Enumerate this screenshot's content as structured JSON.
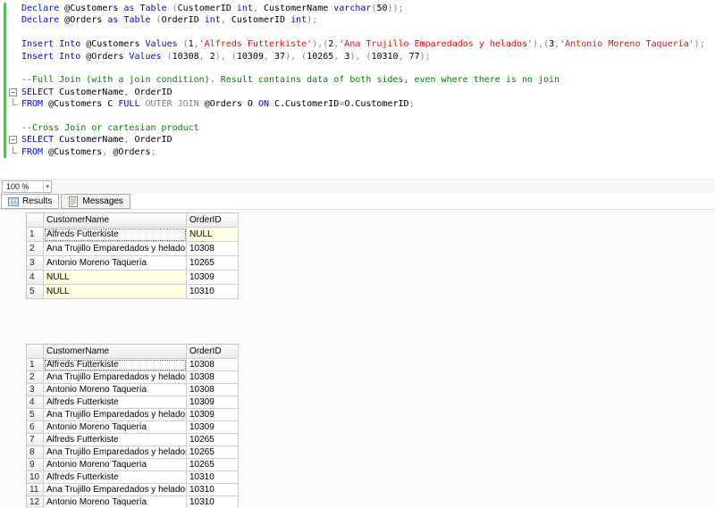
{
  "colors": {
    "keyword_blue": "#0000ff",
    "string_red": "#ff0000",
    "comment_green": "#008000",
    "operator_gray": "#808080",
    "null_cell_yellow": "#ffffe1",
    "change_bar_green": "#5bb75b"
  },
  "editor": {
    "zoom_label": "100 %",
    "lines": [
      {
        "tokens": [
          [
            "kw",
            "Declare"
          ],
          [
            "pl",
            " @Customers "
          ],
          [
            "kw",
            "as"
          ],
          [
            "pl",
            " "
          ],
          [
            "kw",
            "Table"
          ],
          [
            "op",
            " ("
          ],
          [
            "pl",
            "CustomerID "
          ],
          [
            "kw",
            "int"
          ],
          [
            "op",
            ","
          ],
          [
            "pl",
            " CustomerName "
          ],
          [
            "kw",
            "varchar"
          ],
          [
            "op",
            "("
          ],
          [
            "num",
            "50"
          ],
          [
            "op",
            "));"
          ]
        ]
      },
      {
        "tokens": [
          [
            "kw",
            "Declare"
          ],
          [
            "pl",
            " @Orders "
          ],
          [
            "kw",
            "as"
          ],
          [
            "pl",
            " "
          ],
          [
            "kw",
            "Table"
          ],
          [
            "op",
            " ("
          ],
          [
            "pl",
            "OrderID "
          ],
          [
            "kw",
            "int"
          ],
          [
            "op",
            ","
          ],
          [
            "pl",
            " CustomerID "
          ],
          [
            "kw",
            "int"
          ],
          [
            "op",
            ");"
          ]
        ]
      },
      {
        "tokens": []
      },
      {
        "tokens": [
          [
            "kw",
            "Insert Into"
          ],
          [
            "pl",
            " @Customers "
          ],
          [
            "kw",
            "Values"
          ],
          [
            "op",
            " ("
          ],
          [
            "num",
            "1"
          ],
          [
            "op",
            ","
          ],
          [
            "str",
            "'Alfreds Futterkiste'"
          ],
          [
            "op",
            "),("
          ],
          [
            "num",
            "2"
          ],
          [
            "op",
            ","
          ],
          [
            "str",
            "'Ana Trujillo Emparedados y helados'"
          ],
          [
            "op",
            "),("
          ],
          [
            "num",
            "3"
          ],
          [
            "op",
            ","
          ],
          [
            "str",
            "'Antonio Moreno Taquería'"
          ],
          [
            "op",
            ");"
          ]
        ]
      },
      {
        "tokens": [
          [
            "kw",
            "Insert Into"
          ],
          [
            "pl",
            " @Orders "
          ],
          [
            "kw",
            "Values"
          ],
          [
            "op",
            " ("
          ],
          [
            "num",
            "10308"
          ],
          [
            "op",
            ", "
          ],
          [
            "num",
            "2"
          ],
          [
            "op",
            "), ("
          ],
          [
            "num",
            "10309"
          ],
          [
            "op",
            ", "
          ],
          [
            "num",
            "37"
          ],
          [
            "op",
            "), ("
          ],
          [
            "num",
            "10265"
          ],
          [
            "op",
            ", "
          ],
          [
            "num",
            "3"
          ],
          [
            "op",
            "), ("
          ],
          [
            "num",
            "10310"
          ],
          [
            "op",
            ", "
          ],
          [
            "num",
            "77"
          ],
          [
            "op",
            ");"
          ]
        ]
      },
      {
        "tokens": []
      },
      {
        "tokens": [
          [
            "cm",
            "--Full Join (with a join condition). Result contains data of both sides, even where there is no join"
          ]
        ]
      },
      {
        "fold": true,
        "tokens": [
          [
            "kw",
            "SELECT"
          ],
          [
            "pl",
            " CustomerName"
          ],
          [
            "op",
            ","
          ],
          [
            "pl",
            " OrderID"
          ]
        ]
      },
      {
        "fold_tail": true,
        "tokens": [
          [
            "kw",
            "FROM"
          ],
          [
            "pl",
            " @Customers C "
          ],
          [
            "kw",
            "FULL"
          ],
          [
            "op",
            " OUTER JOIN"
          ],
          [
            "pl",
            " @Orders O "
          ],
          [
            "kw",
            "ON"
          ],
          [
            "pl",
            " C.CustomerID"
          ],
          [
            "op",
            "="
          ],
          [
            "pl",
            "O.CustomerID"
          ],
          [
            "op",
            ";"
          ]
        ]
      },
      {
        "tokens": []
      },
      {
        "tokens": [
          [
            "cm",
            "--Cross Join or cartesian product"
          ]
        ]
      },
      {
        "fold": true,
        "tokens": [
          [
            "kw",
            "SELECT"
          ],
          [
            "pl",
            " CustomerName"
          ],
          [
            "op",
            ","
          ],
          [
            "pl",
            " OrderID"
          ]
        ]
      },
      {
        "fold_tail": true,
        "tokens": [
          [
            "kw",
            "FROM"
          ],
          [
            "pl",
            " @Customers"
          ],
          [
            "op",
            ","
          ],
          [
            "pl",
            " @Orders"
          ],
          [
            "op",
            ";"
          ]
        ]
      }
    ]
  },
  "tabs": [
    {
      "label": "Results",
      "icon": "results-grid-icon",
      "active": true
    },
    {
      "label": "Messages",
      "icon": "messages-icon",
      "active": false
    }
  ],
  "grids": [
    {
      "name": "full-join-result",
      "columns": [
        "CustomerName",
        "OrderID"
      ],
      "rows": [
        {
          "n": "1",
          "cells": [
            {
              "v": "Alfreds Futterkiste",
              "focus": true
            },
            {
              "v": "NULL",
              "is_null": true
            }
          ]
        },
        {
          "n": "2",
          "cells": [
            {
              "v": "Ana Trujillo Emparedados y helados"
            },
            {
              "v": "10308"
            }
          ]
        },
        {
          "n": "3",
          "cells": [
            {
              "v": "Antonio Moreno Taquería"
            },
            {
              "v": "10265"
            }
          ]
        },
        {
          "n": "4",
          "cells": [
            {
              "v": "NULL",
              "is_null": true
            },
            {
              "v": "10309"
            }
          ]
        },
        {
          "n": "5",
          "cells": [
            {
              "v": "NULL",
              "is_null": true
            },
            {
              "v": "10310"
            }
          ]
        }
      ]
    },
    {
      "name": "cross-join-result",
      "columns": [
        "CustomerName",
        "OrderID"
      ],
      "rows": [
        {
          "n": "1",
          "cells": [
            {
              "v": "Alfreds Futterkiste",
              "focus": true
            },
            {
              "v": "10308"
            }
          ]
        },
        {
          "n": "2",
          "cells": [
            {
              "v": "Ana Trujillo Emparedados y helados"
            },
            {
              "v": "10308"
            }
          ]
        },
        {
          "n": "3",
          "cells": [
            {
              "v": "Antonio Moreno Taquería"
            },
            {
              "v": "10308"
            }
          ]
        },
        {
          "n": "4",
          "cells": [
            {
              "v": "Alfreds Futterkiste"
            },
            {
              "v": "10309"
            }
          ]
        },
        {
          "n": "5",
          "cells": [
            {
              "v": "Ana Trujillo Emparedados y helados"
            },
            {
              "v": "10309"
            }
          ]
        },
        {
          "n": "6",
          "cells": [
            {
              "v": "Antonio Moreno Taquería"
            },
            {
              "v": "10309"
            }
          ]
        },
        {
          "n": "7",
          "cells": [
            {
              "v": "Alfreds Futterkiste"
            },
            {
              "v": "10265"
            }
          ]
        },
        {
          "n": "8",
          "cells": [
            {
              "v": "Ana Trujillo Emparedados y helados"
            },
            {
              "v": "10265"
            }
          ]
        },
        {
          "n": "9",
          "cells": [
            {
              "v": "Antonio Moreno Taquería"
            },
            {
              "v": "10265"
            }
          ]
        },
        {
          "n": "10",
          "cells": [
            {
              "v": "Alfreds Futterkiste"
            },
            {
              "v": "10310"
            }
          ]
        },
        {
          "n": "11",
          "cells": [
            {
              "v": "Ana Trujillo Emparedados y helados"
            },
            {
              "v": "10310"
            }
          ]
        },
        {
          "n": "12",
          "cells": [
            {
              "v": "Antonio Moreno Taquería"
            },
            {
              "v": "10310"
            }
          ]
        }
      ]
    }
  ]
}
